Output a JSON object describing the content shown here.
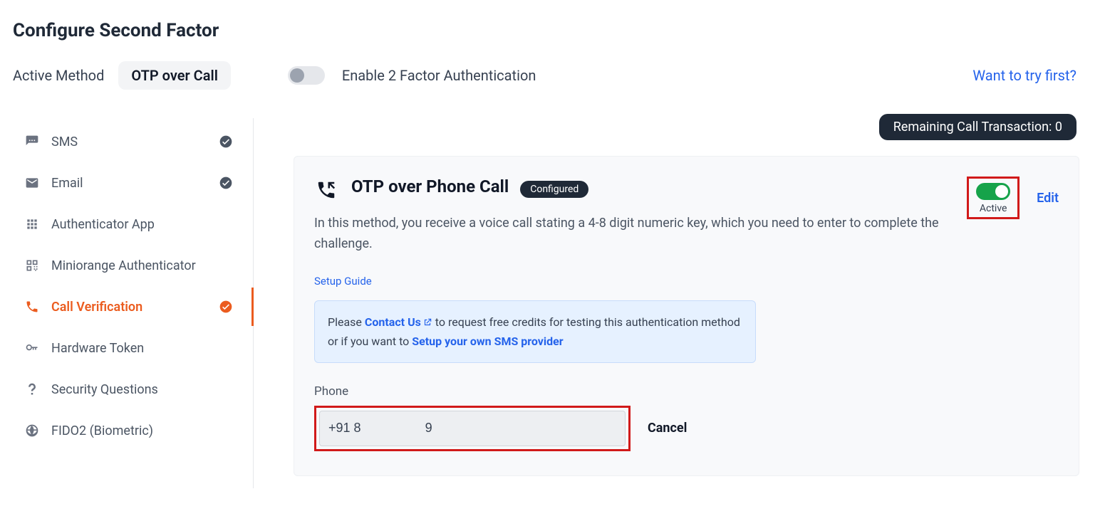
{
  "page": {
    "title": "Configure Second Factor"
  },
  "top": {
    "active_method_label": "Active Method",
    "active_method_value": "OTP over Call",
    "enable_2fa_label": "Enable 2 Factor Authentication",
    "try_link": "Want to try first?"
  },
  "sidebar": {
    "items": [
      {
        "label": "SMS",
        "configured": true
      },
      {
        "label": "Email",
        "configured": true
      },
      {
        "label": "Authenticator App",
        "configured": false
      },
      {
        "label": "Miniorange Authenticator",
        "configured": false
      },
      {
        "label": "Call Verification",
        "configured": true,
        "active": true
      },
      {
        "label": "Hardware Token",
        "configured": false
      },
      {
        "label": "Security Questions",
        "configured": false
      },
      {
        "label": "FIDO2 (Biometric)",
        "configured": false
      }
    ]
  },
  "main": {
    "remaining_label": "Remaining Call Transaction: 0",
    "card": {
      "title": "OTP over Phone Call",
      "configured_pill": "Configured",
      "description": "In this method, you receive a voice call stating a 4-8 digit numeric key, which you need to enter to complete the challenge.",
      "active_toggle_label": "Active",
      "edit_label": "Edit",
      "setup_guide": "Setup Guide",
      "info": {
        "prefix": "Please ",
        "contact": "Contact Us",
        "mid": " to request free credits for testing this authentication method or if you want to ",
        "setup_link": "Setup your own SMS provider"
      },
      "phone_label": "Phone",
      "phone_value": "+91 8                  9",
      "cancel_label": "Cancel"
    }
  }
}
